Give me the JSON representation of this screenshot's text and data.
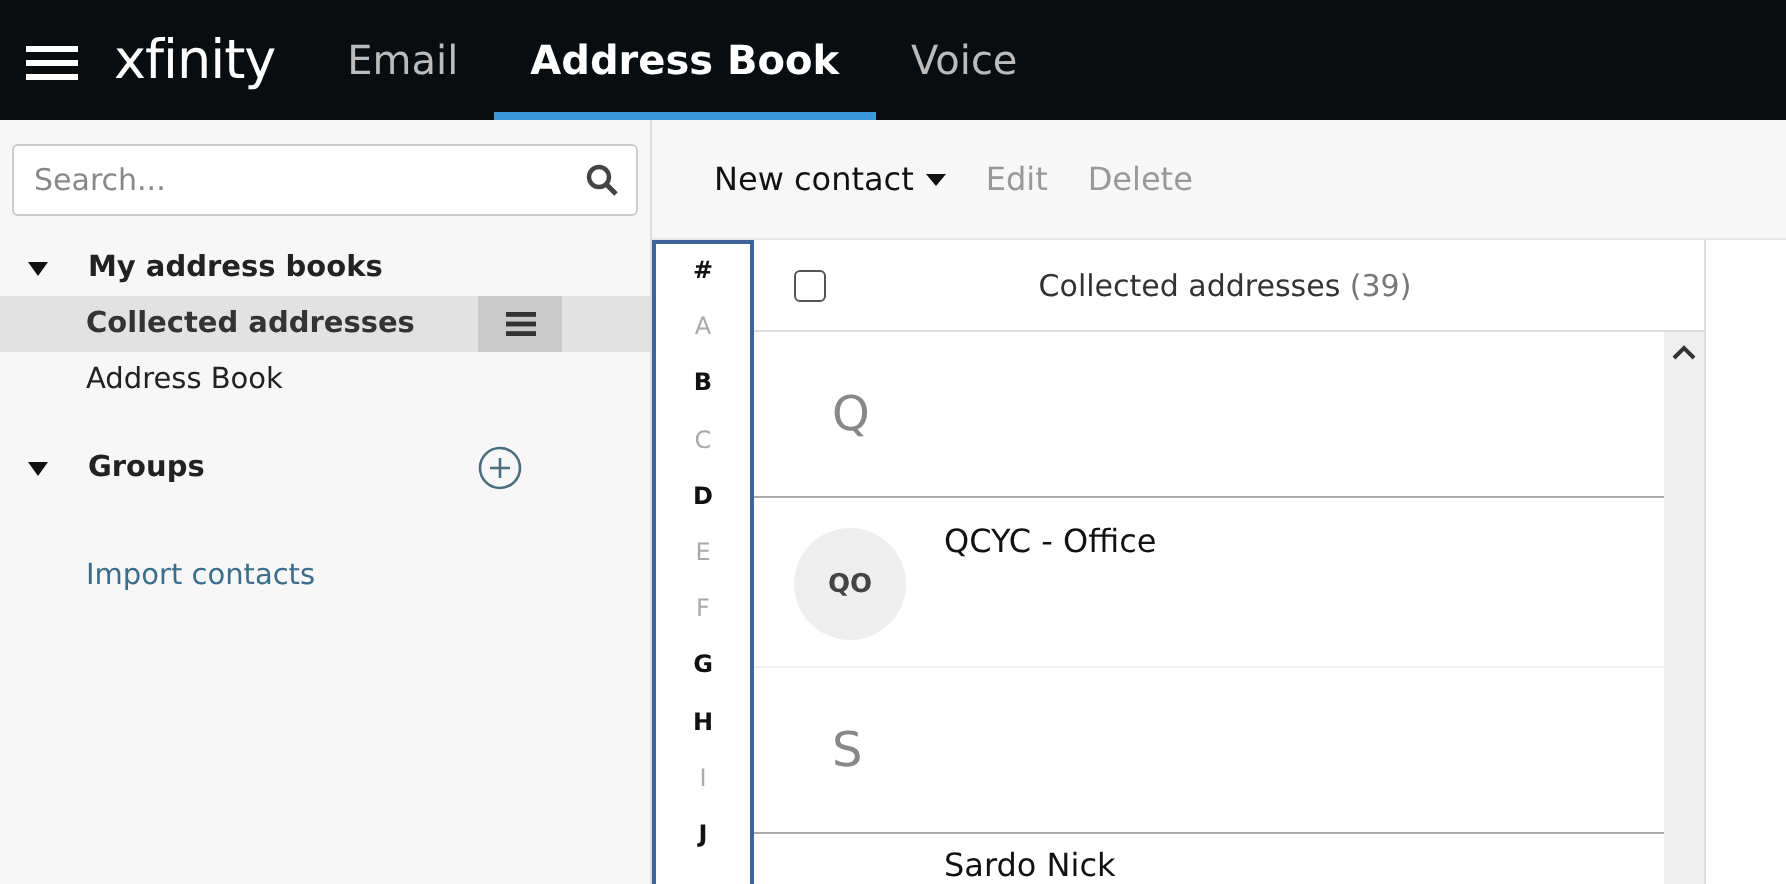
{
  "topbar": {
    "logo": "xfinity",
    "tabs": [
      {
        "label": "Email",
        "selected": false
      },
      {
        "label": "Address Book",
        "selected": true
      },
      {
        "label": "Voice",
        "selected": false
      }
    ]
  },
  "search": {
    "placeholder": "Search..."
  },
  "sidebar": {
    "sections": [
      {
        "title": "My address books",
        "expanded": true,
        "add_button": false,
        "items": [
          {
            "label": "Collected addresses",
            "selected": true
          },
          {
            "label": "Address Book",
            "selected": false
          }
        ]
      },
      {
        "title": "Groups",
        "expanded": true,
        "add_button": true
      }
    ],
    "import_link": "Import contacts"
  },
  "toolbar": {
    "buttons": [
      {
        "label": "New contact",
        "disabled": false,
        "dropdown": true
      },
      {
        "label": "Edit",
        "disabled": true,
        "dropdown": false
      },
      {
        "label": "Delete",
        "disabled": true,
        "dropdown": false
      }
    ]
  },
  "alphabet": [
    {
      "letter": "#",
      "disabled": false
    },
    {
      "letter": "A",
      "disabled": true
    },
    {
      "letter": "B",
      "disabled": false
    },
    {
      "letter": "C",
      "disabled": true
    },
    {
      "letter": "D",
      "disabled": false
    },
    {
      "letter": "E",
      "disabled": true
    },
    {
      "letter": "F",
      "disabled": true
    },
    {
      "letter": "G",
      "disabled": false
    },
    {
      "letter": "H",
      "disabled": false
    },
    {
      "letter": "I",
      "disabled": true
    },
    {
      "letter": "J",
      "disabled": false
    }
  ],
  "list": {
    "title": "Collected addresses",
    "count": "(39)",
    "select_all_checked": false,
    "groups": [
      {
        "letter": "Q",
        "contacts": [
          {
            "initials": "QO",
            "name": "QCYC - Office"
          }
        ]
      },
      {
        "letter": "S",
        "contacts": [
          {
            "name": "Sardo Nick"
          }
        ]
      }
    ]
  }
}
